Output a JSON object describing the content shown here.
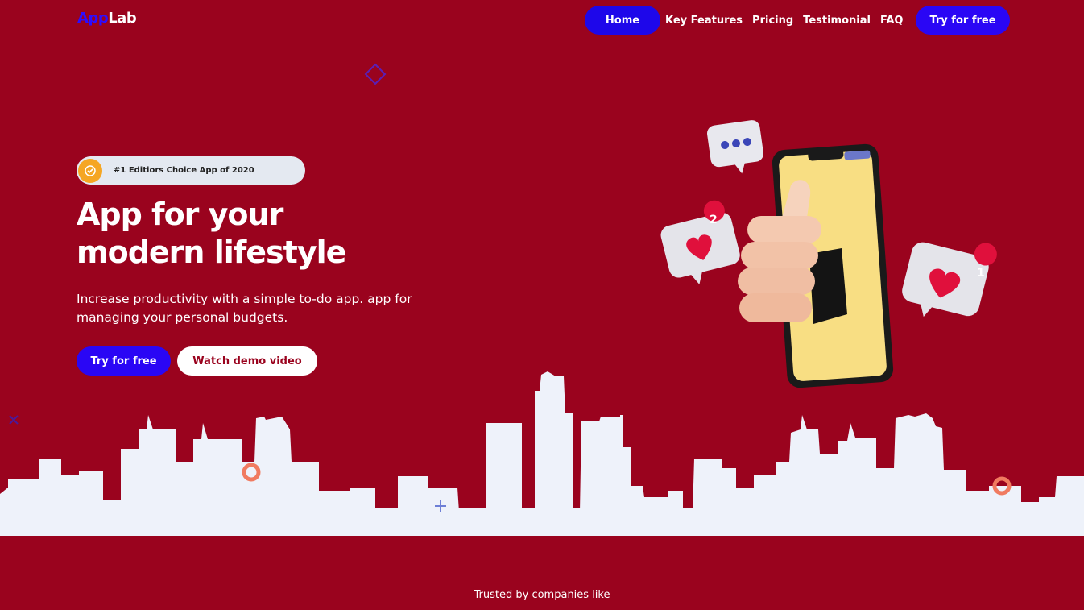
{
  "brand": {
    "logo_part1": "App",
    "logo_part2": "Lab"
  },
  "nav": {
    "items": [
      "Home",
      "Key Features",
      "Pricing",
      "Testimonial",
      "FAQ"
    ],
    "cta": "Try for free"
  },
  "hero": {
    "badge_icon": "check-badge-icon",
    "badge_text": "#1 Editiors Choice App of 2020",
    "title_line1": "App for your",
    "title_line2": "modern lifestyle",
    "subtitle": "Increase productivity with a simple to-do app. app for managing your personal budgets.",
    "primary_button": "Try for free",
    "secondary_button": "Watch demo video"
  },
  "illustration": {
    "bubble_left_count": "2",
    "bubble_right_count": "1"
  },
  "footer": {
    "trusted_text": "Trusted by companies like"
  },
  "colors": {
    "background": "#9a031e",
    "accent": "#2a06f5",
    "skyline": "#eef2fa"
  }
}
